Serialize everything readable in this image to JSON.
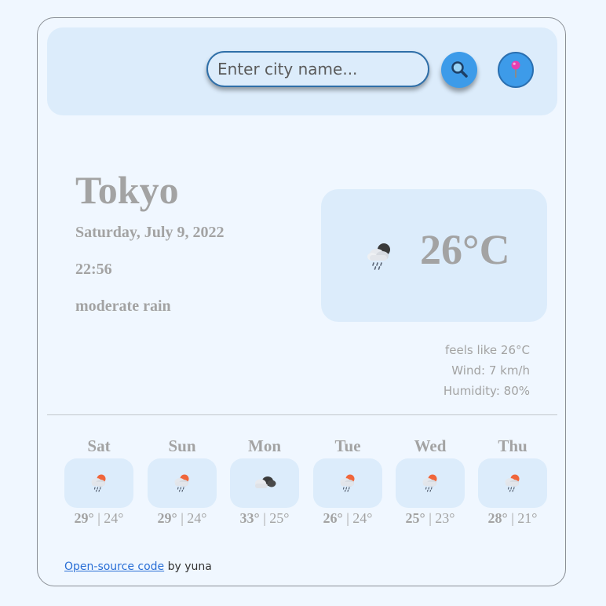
{
  "search": {
    "placeholder": "Enter city name...",
    "value": "",
    "search_icon": "magnifier-icon",
    "location_icon": "location-pin-icon"
  },
  "current": {
    "city": "Tokyo",
    "date": "Saturday, July 9, 2022",
    "time": "22:56",
    "description": "moderate rain",
    "temp": "26°C",
    "icon": "rain-night-icon",
    "feels_like": "feels like 26°C",
    "wind": "Wind: 7 km/h",
    "humidity": "Humidity: 80%"
  },
  "forecast": [
    {
      "day": "Sat",
      "hi": "29°",
      "sep": " | ",
      "lo": "24°",
      "icon": "rain-day-icon"
    },
    {
      "day": "Sun",
      "hi": "29°",
      "sep": " | ",
      "lo": "24°",
      "icon": "rain-day-icon"
    },
    {
      "day": "Mon",
      "hi": "33°",
      "sep": " | ",
      "lo": "25°",
      "icon": "cloudy-icon"
    },
    {
      "day": "Tue",
      "hi": "26°",
      "sep": " | ",
      "lo": "24°",
      "icon": "rain-day-icon"
    },
    {
      "day": "Wed",
      "hi": "25°",
      "sep": " | ",
      "lo": "23°",
      "icon": "rain-day-icon"
    },
    {
      "day": "Thu",
      "hi": "28°",
      "sep": " | ",
      "lo": "21°",
      "icon": "rain-day-icon"
    }
  ],
  "footer": {
    "link_text": "Open-source code",
    "by_text": " by yuna"
  },
  "colors": {
    "background": "#f0f7ff",
    "panel": "#dcecfb",
    "button": "#3d9be9",
    "text_muted": "#a3a3a3",
    "link": "#2a6fd6"
  }
}
